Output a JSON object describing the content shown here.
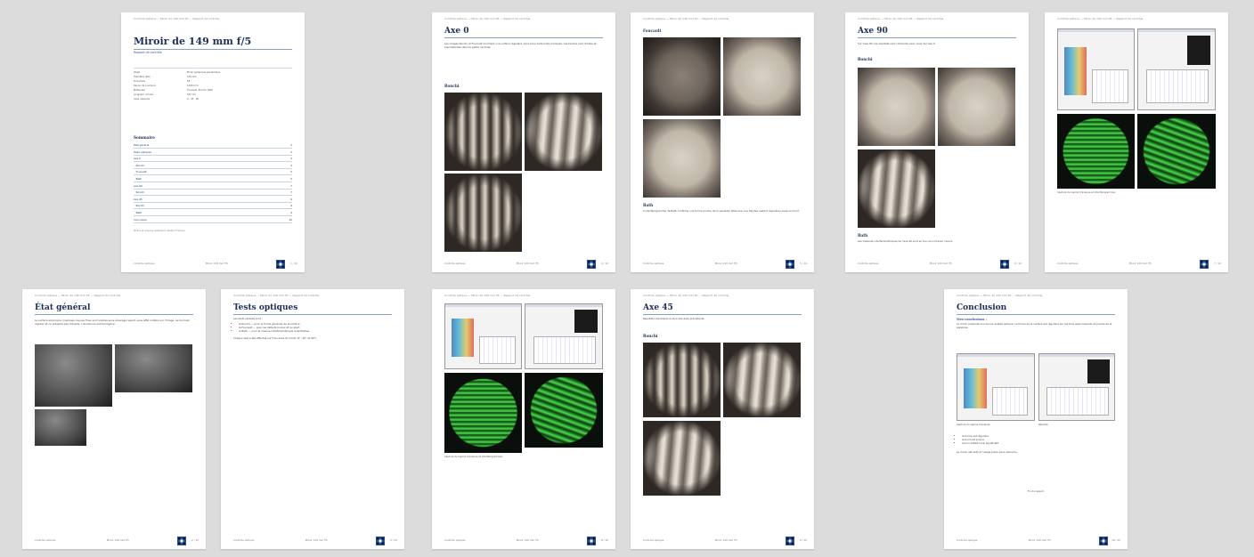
{
  "header_text": "Contrôle optique — Miroir de 149 mm f/5 — Rapport de contrôle",
  "footer_left": "Contrôle optique",
  "footer_center": "Miroir 149 mm f/5",
  "pages": {
    "cover": {
      "title": "Miroir de 149 mm f/5",
      "subtitle": "Rapport de contrôle",
      "meta": [
        {
          "k": "Objet",
          "v": "Miroir sphérique parabolique"
        },
        {
          "k": "Diamètre utile",
          "v": "149 mm"
        },
        {
          "k": "Ouverture",
          "v": "f/5"
        },
        {
          "k": "Rayon de courbure",
          "v": "1490 mm"
        },
        {
          "k": "Méthodes",
          "v": "Foucault, Ronchi, Bath"
        },
        {
          "k": "Longueur d'onde",
          "v": "532 nm"
        },
        {
          "k": "Axes mesurés",
          "v": "0 · 45 · 90"
        }
      ],
      "toc_title": "Sommaire",
      "toc": [
        {
          "label": "État général",
          "page": "2"
        },
        {
          "label": "Tests optiques",
          "page": "3"
        },
        {
          "label": "Axe 0",
          "page": "4"
        },
        {
          "label": "   Ronchi",
          "page": "4"
        },
        {
          "label": "   Foucault",
          "page": "5"
        },
        {
          "label": "   Bath",
          "page": "5"
        },
        {
          "label": "Axe 90",
          "page": "7"
        },
        {
          "label": "   Ronchi",
          "page": "7"
        },
        {
          "label": "Axe 45",
          "page": "9"
        },
        {
          "label": "   Ronchi",
          "page": "9"
        },
        {
          "label": "   Bath",
          "page": "9"
        },
        {
          "label": "Conclusion",
          "page": "10"
        }
      ],
      "note": "Photos et mesures réalisées à l'atelier d'optique."
    },
    "etat": {
      "title": "État général",
      "body": "La surface est propre. Quelques rayures fines sont visibles sous éclairage rasant, sans effet notable sur l'image. Le bord est régulier et ne présente pas d'écaille. L'aluminure est homogène."
    },
    "tests": {
      "title": "Tests optiques",
      "intro": "Les tests réalisés sont :",
      "bullets": [
        "le Ronchi — pour la forme générale de la surface ;",
        "le Foucault — pour les défauts locaux et le relief ;",
        "le Bath — pour la mesure interférométrique quantitative."
      ],
      "outro": "Chaque test a été effectué sur trois axes du miroir (0°, 45° et 90°)."
    },
    "axe0": {
      "title": "Axe 0",
      "body": "Les images Ronchi et Foucault montrent une surface régulière, sans zone turbulente marquée. Les bandes sont droites et équidistantes dans la partie centrale.",
      "sub_ronchi": "Ronchi",
      "sub_foucault": "Foucault",
      "sub_bath": "Bath",
      "bath_text": "L'interférogramme de Bath confirme une forme proche de la parabole attendue. Les bandes restent régulières jusqu'au bord."
    },
    "axe90": {
      "title": "Axe 90",
      "body": "Sur l'axe 90, les résultats sont cohérents avec ceux de l'axe 0.",
      "sub_ronchi": "Ronchi",
      "sub_bath": "Bath",
      "bath_text": "Les mesures interférométriques de l'axe 90 sont en bon accord avec l'axe 0.",
      "caption": "Capture du logiciel d'analyse et interférogrammes"
    },
    "axe45": {
      "title": "Axe 45",
      "body": "Résultats identiques à ceux des axes précédents.",
      "sub_ronchi": "Ronchi",
      "caption": "Capture du logiciel d'analyse et interférogrammes"
    },
    "conclusion": {
      "title": "Conclusion",
      "sub": "Mes conclusions :",
      "body1": "Le miroir présente une bonne qualité optique. La forme de la surface est régulière sur les trois axes mesurés et proche de la parabole.",
      "caption_left": "Capture du logiciel d'analyse",
      "caption_right": "Résultat",
      "bullets": [
        "la forme est régulière",
        "le bord est propre",
        "aucun défaut local significatif"
      ],
      "body2": "Le miroir est apte à l'usage prévu sans retouche.",
      "end": "Fin du rapport"
    }
  },
  "page_numbers": [
    "1 / 10",
    "4 / 10",
    "5 / 10",
    "6 / 10",
    "7 / 10",
    "2 / 10",
    "3 / 10",
    "8 / 10",
    "9 / 10",
    "10 / 10"
  ]
}
